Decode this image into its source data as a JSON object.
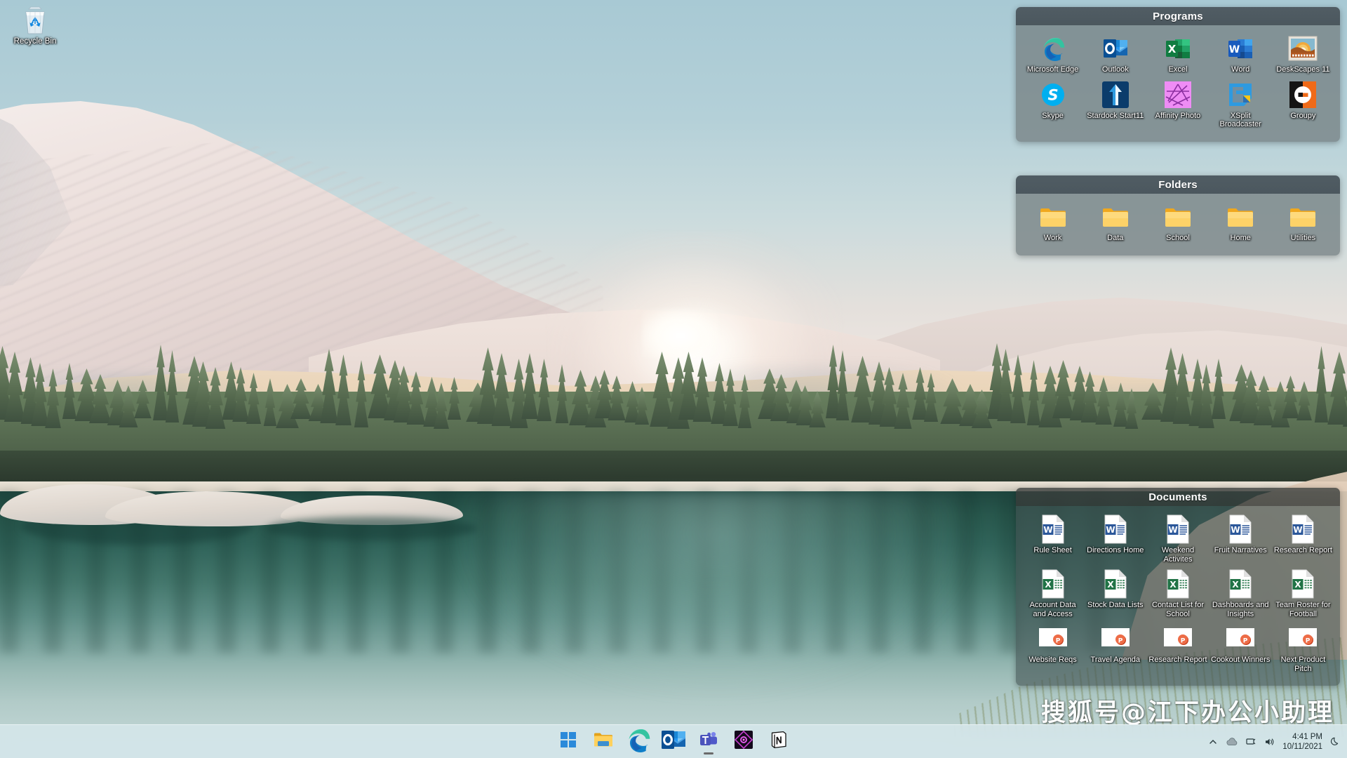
{
  "desktop": {
    "icons": [
      {
        "name": "recycle-bin",
        "label": "Recycle Bin",
        "icon": "recycle-bin-icon"
      }
    ],
    "watermark": "搜狐号@江下办公小助理"
  },
  "fences": [
    {
      "id": "programs",
      "title": "Programs",
      "items": [
        {
          "label": "Microsoft Edge",
          "icon": "microsoft-edge-icon"
        },
        {
          "label": "Outlook",
          "icon": "outlook-icon"
        },
        {
          "label": "Excel",
          "icon": "excel-icon"
        },
        {
          "label": "Word",
          "icon": "word-icon"
        },
        {
          "label": "DeskScapes 11",
          "icon": "deskscapes-icon"
        },
        {
          "label": "Skype",
          "icon": "skype-icon"
        },
        {
          "label": "Stardock Start11",
          "icon": "start11-icon"
        },
        {
          "label": "Affinity Photo",
          "icon": "affinity-photo-icon"
        },
        {
          "label": "XSplit Broadcaster",
          "icon": "xsplit-icon"
        },
        {
          "label": "Groupy",
          "icon": "groupy-icon"
        }
      ]
    },
    {
      "id": "folders",
      "title": "Folders",
      "items": [
        {
          "label": "Work",
          "icon": "folder-icon"
        },
        {
          "label": "Data",
          "icon": "folder-icon"
        },
        {
          "label": "School",
          "icon": "folder-icon"
        },
        {
          "label": "Home",
          "icon": "folder-icon"
        },
        {
          "label": "Utilities",
          "icon": "folder-icon"
        }
      ]
    },
    {
      "id": "documents",
      "title": "Documents",
      "items": [
        {
          "label": "Rule Sheet",
          "icon": "word-doc-icon"
        },
        {
          "label": "Directions Home",
          "icon": "word-doc-icon"
        },
        {
          "label": "Weekend Activites",
          "icon": "word-doc-icon"
        },
        {
          "label": "Fruit Narratives",
          "icon": "word-doc-icon"
        },
        {
          "label": "Research Report",
          "icon": "word-doc-icon"
        },
        {
          "label": "Account Data and Access",
          "icon": "excel-doc-icon"
        },
        {
          "label": "Stock Data Lists",
          "icon": "excel-doc-icon"
        },
        {
          "label": "Contact List for School",
          "icon": "excel-doc-icon"
        },
        {
          "label": "Dashboards and Insights",
          "icon": "excel-doc-icon"
        },
        {
          "label": "Team Roster for Football",
          "icon": "excel-doc-icon"
        },
        {
          "label": "Website Reqs",
          "icon": "powerpoint-doc-icon"
        },
        {
          "label": "Travel Agenda",
          "icon": "powerpoint-doc-icon"
        },
        {
          "label": "Research Report",
          "icon": "powerpoint-doc-icon"
        },
        {
          "label": "Cookout Winners",
          "icon": "powerpoint-doc-icon"
        },
        {
          "label": "Next Product Pitch",
          "icon": "powerpoint-doc-icon"
        }
      ]
    }
  ],
  "taskbar": {
    "buttons": [
      {
        "name": "start-button",
        "icon": "windows-start-icon",
        "label": "Start",
        "running": false
      },
      {
        "name": "file-explorer-button",
        "icon": "file-explorer-icon",
        "label": "File Explorer",
        "running": false
      },
      {
        "name": "edge-button",
        "icon": "microsoft-edge-icon",
        "label": "Microsoft Edge",
        "running": false
      },
      {
        "name": "outlook-button",
        "icon": "outlook-icon",
        "label": "Outlook",
        "running": false
      },
      {
        "name": "teams-button",
        "icon": "microsoft-teams-icon",
        "label": "Microsoft Teams",
        "running": true
      },
      {
        "name": "obs-button",
        "icon": "dark-diamond-app-icon",
        "label": "Broadcast App",
        "running": false
      },
      {
        "name": "notion-button",
        "icon": "notion-icon",
        "label": "Notion",
        "running": false
      }
    ],
    "tray": [
      {
        "name": "show-hidden-icons",
        "icon": "chevron-up-icon"
      },
      {
        "name": "onedrive-tray-icon",
        "icon": "cloud-icon"
      },
      {
        "name": "network-tray-icon",
        "icon": "wifi-icon"
      },
      {
        "name": "volume-tray-icon",
        "icon": "speaker-icon"
      }
    ],
    "clock": {
      "time": "4:41 PM",
      "date": "10/11/2021"
    },
    "notification": {
      "name": "notifications-button",
      "icon": "moon-icon"
    }
  },
  "colors": {
    "fence_header": "#4b575e",
    "fence_body": "#788386",
    "taskbar": "#d5e6e9",
    "word_blue": "#2b579a",
    "excel_green": "#217346",
    "powerpoint_orange": "#d24726",
    "folder_yellow": "#fcc94b"
  }
}
